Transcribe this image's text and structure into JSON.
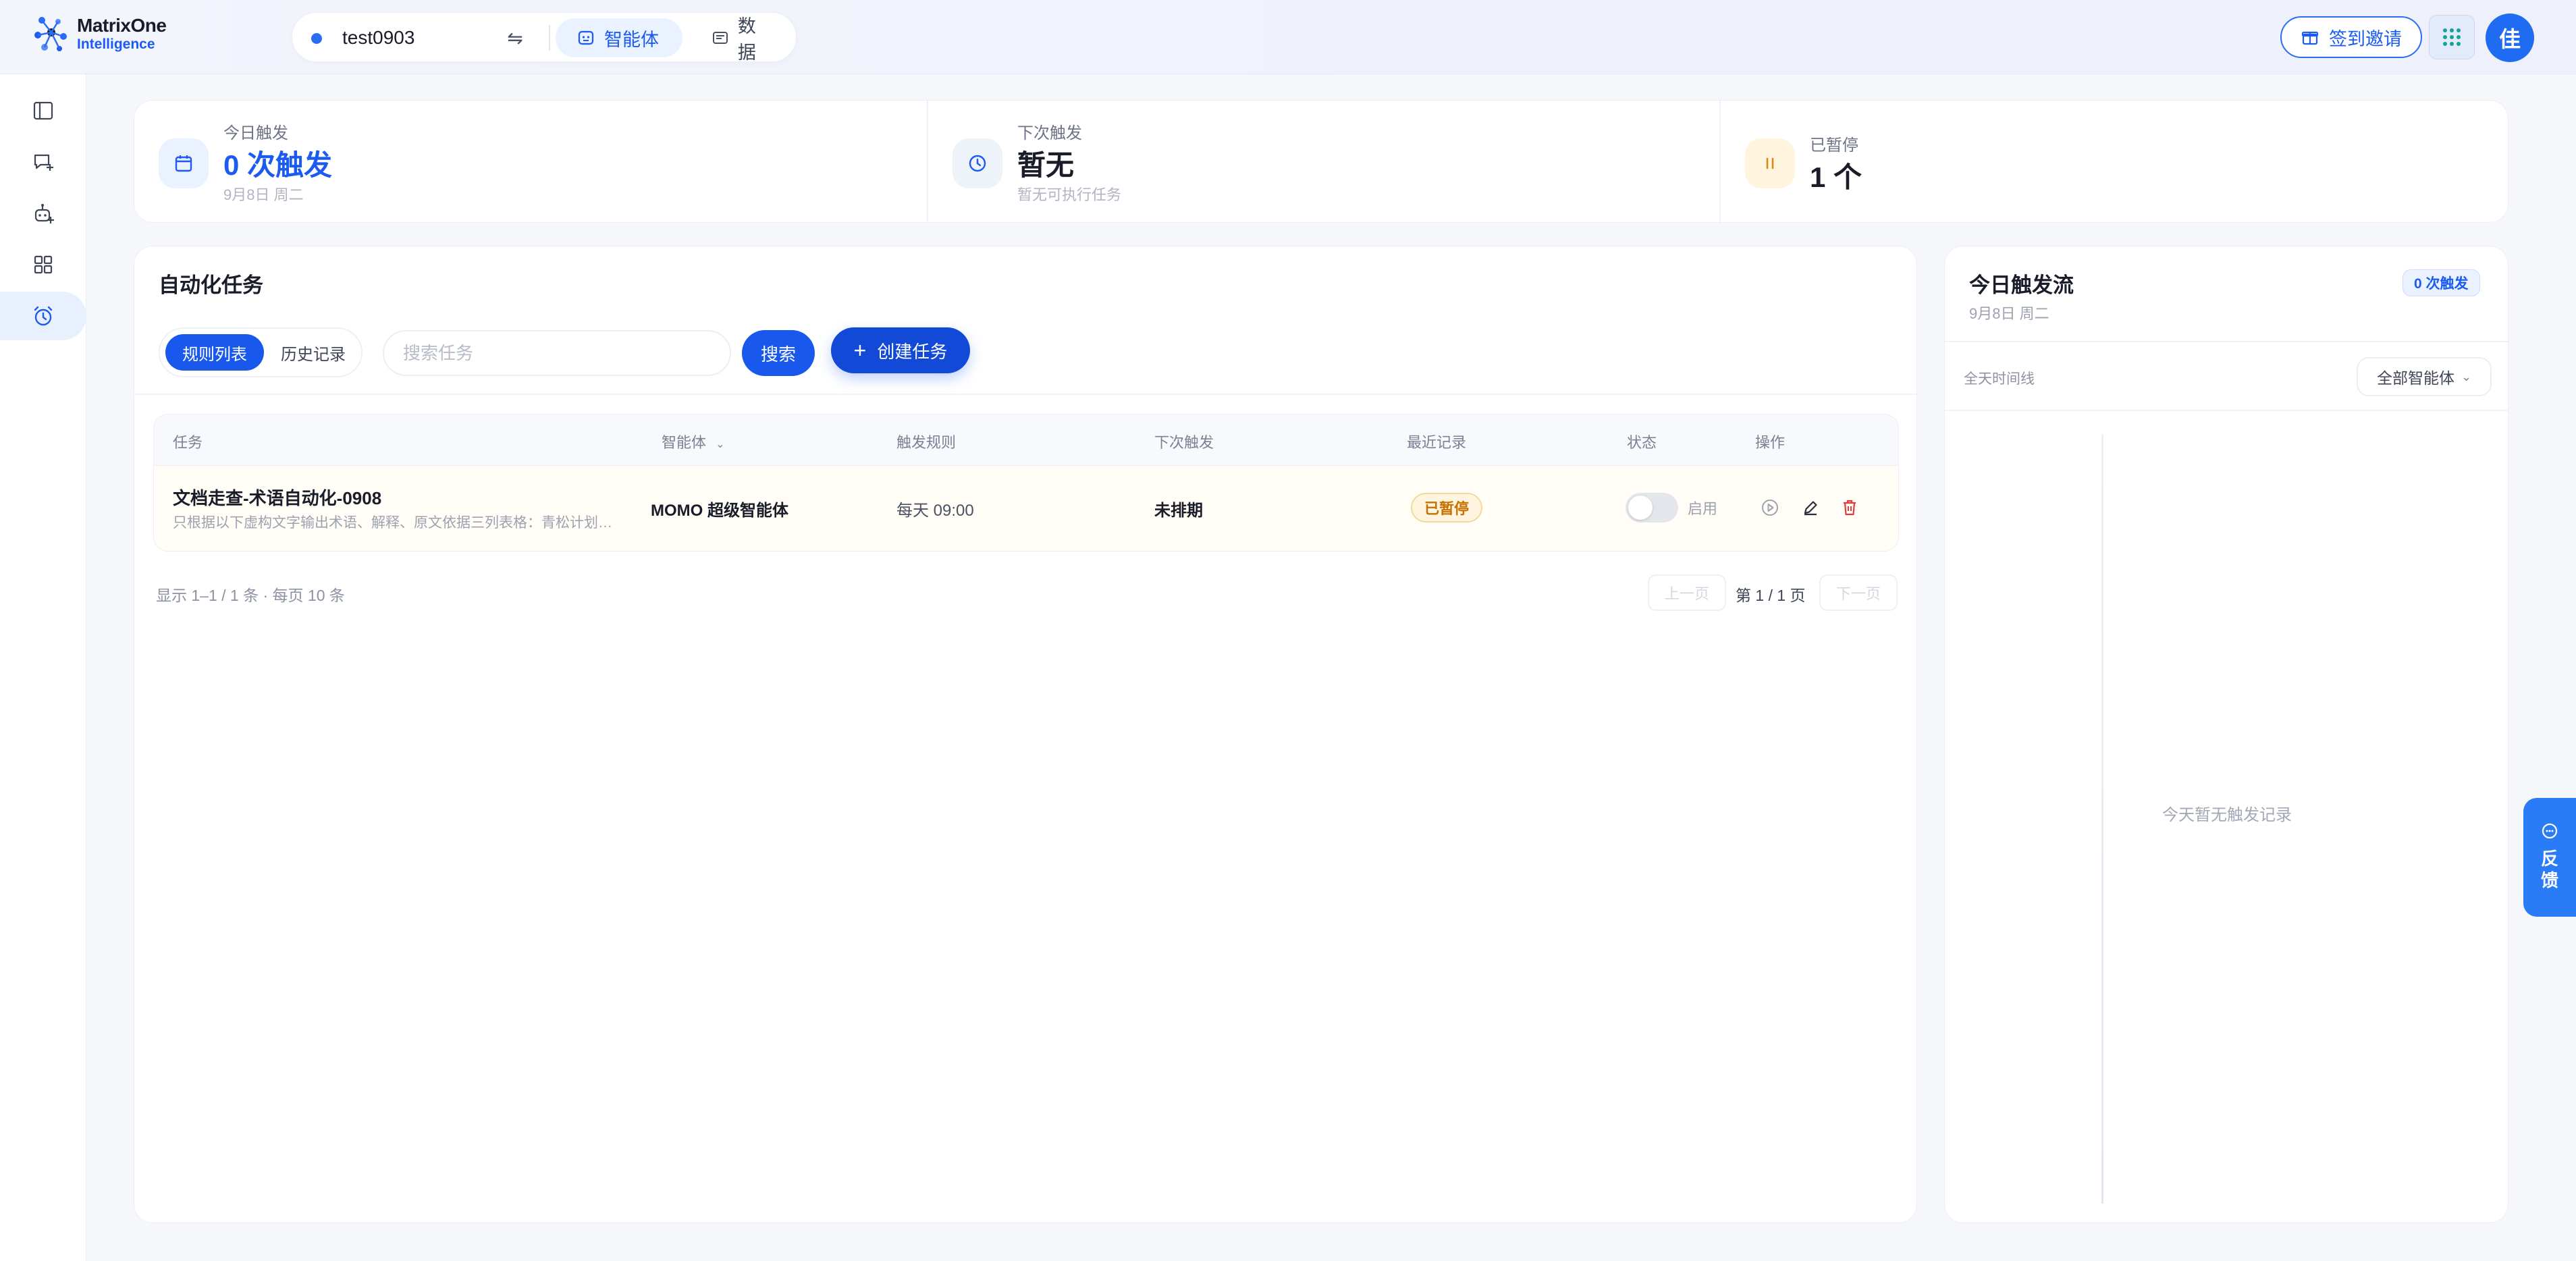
{
  "brand": {
    "line1": "MatrixOne",
    "line2": "Intelligence"
  },
  "workspace": {
    "name": "test0903",
    "tabs": [
      {
        "label": "智能体"
      },
      {
        "label": "数据"
      }
    ]
  },
  "header": {
    "invite_label": "签到邀请",
    "avatar_initial": "佳"
  },
  "stats": [
    {
      "label": "今日触发",
      "value": "0 次触发",
      "sub": "9月8日 周二"
    },
    {
      "label": "下次触发",
      "value": "暂无",
      "sub": "暂无可执行任务"
    },
    {
      "label": "已暂停",
      "value": "1 个",
      "sub": ""
    }
  ],
  "panel": {
    "title": "自动化任务",
    "segments": [
      "规则列表",
      "历史记录"
    ],
    "search_placeholder": "搜索任务",
    "search_button": "搜索",
    "create_button": "创建任务"
  },
  "table": {
    "headers": [
      "任务",
      "智能体",
      "触发规则",
      "下次触发",
      "最近记录",
      "状态",
      "操作"
    ],
    "rows": [
      {
        "name": "文档走查-术语自动化-0908",
        "desc": "只根据以下虚构文字输出术语、解释、原文依据三列表格：青松计划…",
        "agent": "MOMO 超级智能体",
        "rule": "每天 09:00",
        "next": "未排期",
        "last": "已暂停",
        "status_label": "启用"
      }
    ]
  },
  "pagination": {
    "info": "显示 1–1 / 1 条 · 每页 10 条",
    "prev": "上一页",
    "current": "第 1 / 1 页",
    "next": "下一页"
  },
  "flow": {
    "title": "今日触发流",
    "date": "9月8日 周二",
    "badge": "0 次触发",
    "timeline_label": "全天时间线",
    "agent_filter": "全部智能体",
    "empty_text": "今天暂无触发记录"
  },
  "feedback_label": "反馈",
  "colors": {
    "primary": "#1858ec",
    "accent": "#2a7bf6",
    "paused": "#c77100"
  }
}
